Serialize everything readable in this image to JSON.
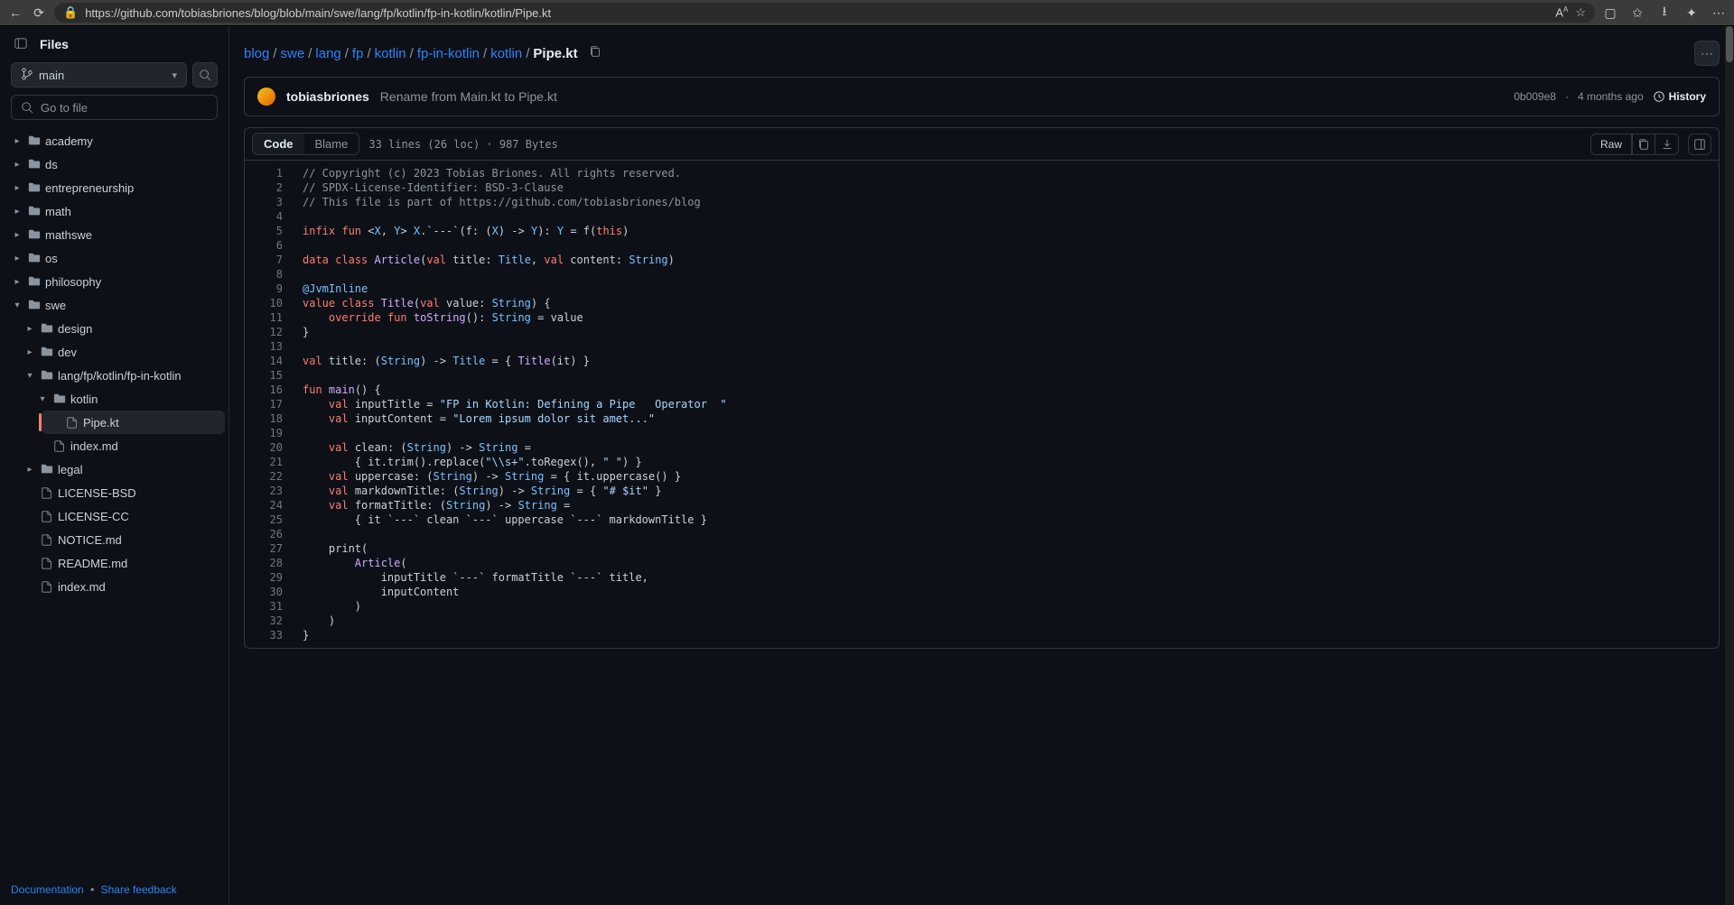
{
  "browser": {
    "url": "https://github.com/tobiasbriones/blog/blob/main/swe/lang/fp/kotlin/fp-in-kotlin/kotlin/Pipe.kt"
  },
  "sidebar": {
    "title": "Files",
    "branch": "main",
    "go_to_file": "Go to file",
    "items": [
      {
        "label": "academy",
        "type": "dir",
        "caret": ">",
        "indent": 0
      },
      {
        "label": "ds",
        "type": "dir",
        "caret": ">",
        "indent": 0
      },
      {
        "label": "entrepreneurship",
        "type": "dir",
        "caret": ">",
        "indent": 0
      },
      {
        "label": "math",
        "type": "dir",
        "caret": ">",
        "indent": 0
      },
      {
        "label": "mathswe",
        "type": "dir",
        "caret": ">",
        "indent": 0
      },
      {
        "label": "os",
        "type": "dir",
        "caret": ">",
        "indent": 0
      },
      {
        "label": "philosophy",
        "type": "dir",
        "caret": ">",
        "indent": 0
      },
      {
        "label": "swe",
        "type": "dir",
        "caret": "v",
        "indent": 0
      },
      {
        "label": "design",
        "type": "dir",
        "caret": ">",
        "indent": 1
      },
      {
        "label": "dev",
        "type": "dir",
        "caret": ">",
        "indent": 1
      },
      {
        "label": "lang/fp/kotlin/fp-in-kotlin",
        "type": "dir",
        "caret": "v",
        "indent": 1
      },
      {
        "label": "kotlin",
        "type": "dir",
        "caret": "v",
        "indent": 2
      },
      {
        "label": "Pipe.kt",
        "type": "file",
        "caret": "",
        "indent": 3,
        "active": true
      },
      {
        "label": "index.md",
        "type": "file",
        "caret": "",
        "indent": 2
      },
      {
        "label": "legal",
        "type": "dir",
        "caret": ">",
        "indent": 1
      },
      {
        "label": "LICENSE-BSD",
        "type": "file",
        "caret": "",
        "indent": 1
      },
      {
        "label": "LICENSE-CC",
        "type": "file",
        "caret": "",
        "indent": 1
      },
      {
        "label": "NOTICE.md",
        "type": "file",
        "caret": "",
        "indent": 1
      },
      {
        "label": "README.md",
        "type": "file",
        "caret": "",
        "indent": 1
      },
      {
        "label": "index.md",
        "type": "file",
        "caret": "",
        "indent": 1
      }
    ],
    "footer": {
      "docs": "Documentation",
      "sep": "•",
      "feedback": "Share feedback"
    }
  },
  "breadcrumb": [
    "blog",
    "swe",
    "lang",
    "fp",
    "kotlin",
    "fp-in-kotlin",
    "kotlin"
  ],
  "breadcrumb_current": "Pipe.kt",
  "commit": {
    "author": "tobiasbriones",
    "message": "Rename from Main.kt to Pipe.kt",
    "sha": "0b009e8",
    "when": "4 months ago",
    "history": "History"
  },
  "toolbar": {
    "code": "Code",
    "blame": "Blame",
    "meta": "33 lines (26 loc) · 987 Bytes",
    "raw": "Raw"
  },
  "code": {
    "line_count": 33,
    "lines": [
      [
        {
          "c": "cm",
          "t": "// Copyright (c) 2023 Tobias Briones. All rights reserved."
        }
      ],
      [
        {
          "c": "cm",
          "t": "// SPDX-License-Identifier: BSD-3-Clause"
        }
      ],
      [
        {
          "c": "cm",
          "t": "// This file is part of https://github.com/tobiasbriones/blog"
        }
      ],
      [],
      [
        {
          "c": "kw",
          "t": "infix"
        },
        {
          "t": " "
        },
        {
          "c": "kw",
          "t": "fun"
        },
        {
          "t": " <"
        },
        {
          "c": "tp",
          "t": "X"
        },
        {
          "t": ", "
        },
        {
          "c": "tp",
          "t": "Y"
        },
        {
          "t": "> "
        },
        {
          "c": "tp",
          "t": "X"
        },
        {
          "t": ".`---`(f: ("
        },
        {
          "c": "tp",
          "t": "X"
        },
        {
          "t": ") -> "
        },
        {
          "c": "tp",
          "t": "Y"
        },
        {
          "t": "): "
        },
        {
          "c": "tp",
          "t": "Y"
        },
        {
          "t": " = f("
        },
        {
          "c": "kw",
          "t": "this"
        },
        {
          "t": ")"
        }
      ],
      [],
      [
        {
          "c": "kw",
          "t": "data"
        },
        {
          "t": " "
        },
        {
          "c": "kw",
          "t": "class"
        },
        {
          "t": " "
        },
        {
          "c": "fn",
          "t": "Article"
        },
        {
          "t": "("
        },
        {
          "c": "kw",
          "t": "val"
        },
        {
          "t": " title: "
        },
        {
          "c": "tp",
          "t": "Title"
        },
        {
          "t": ", "
        },
        {
          "c": "kw",
          "t": "val"
        },
        {
          "t": " content: "
        },
        {
          "c": "tp",
          "t": "String"
        },
        {
          "t": ")"
        }
      ],
      [],
      [
        {
          "c": "nm",
          "t": "@JvmInline"
        }
      ],
      [
        {
          "c": "kw",
          "t": "value"
        },
        {
          "t": " "
        },
        {
          "c": "kw",
          "t": "class"
        },
        {
          "t": " "
        },
        {
          "c": "fn",
          "t": "Title"
        },
        {
          "t": "("
        },
        {
          "c": "kw",
          "t": "val"
        },
        {
          "t": " value: "
        },
        {
          "c": "tp",
          "t": "String"
        },
        {
          "t": ") {"
        }
      ],
      [
        {
          "t": "    "
        },
        {
          "c": "kw",
          "t": "override"
        },
        {
          "t": " "
        },
        {
          "c": "kw",
          "t": "fun"
        },
        {
          "t": " "
        },
        {
          "c": "fn",
          "t": "toString"
        },
        {
          "t": "(): "
        },
        {
          "c": "tp",
          "t": "String"
        },
        {
          "t": " = value"
        }
      ],
      [
        {
          "t": "}"
        }
      ],
      [],
      [
        {
          "c": "kw",
          "t": "val"
        },
        {
          "t": " title: ("
        },
        {
          "c": "tp",
          "t": "String"
        },
        {
          "t": ") -> "
        },
        {
          "c": "tp",
          "t": "Title"
        },
        {
          "t": " = { "
        },
        {
          "c": "fn",
          "t": "Title"
        },
        {
          "t": "(it) }"
        }
      ],
      [],
      [
        {
          "c": "kw",
          "t": "fun"
        },
        {
          "t": " "
        },
        {
          "c": "fn",
          "t": "main"
        },
        {
          "t": "() {"
        }
      ],
      [
        {
          "t": "    "
        },
        {
          "c": "kw",
          "t": "val"
        },
        {
          "t": " inputTitle = "
        },
        {
          "c": "st",
          "t": "\"FP in Kotlin: Defining a Pipe   Operator  \""
        }
      ],
      [
        {
          "t": "    "
        },
        {
          "c": "kw",
          "t": "val"
        },
        {
          "t": " inputContent = "
        },
        {
          "c": "st",
          "t": "\"Lorem ipsum dolor sit amet...\""
        }
      ],
      [],
      [
        {
          "t": "    "
        },
        {
          "c": "kw",
          "t": "val"
        },
        {
          "t": " clean: ("
        },
        {
          "c": "tp",
          "t": "String"
        },
        {
          "t": ") -> "
        },
        {
          "c": "tp",
          "t": "String"
        },
        {
          "t": " ="
        }
      ],
      [
        {
          "t": "        { it.trim().replace("
        },
        {
          "c": "st",
          "t": "\"\\\\s+\""
        },
        {
          "t": ".toRegex(), "
        },
        {
          "c": "st",
          "t": "\" \""
        },
        {
          "t": ") }"
        }
      ],
      [
        {
          "t": "    "
        },
        {
          "c": "kw",
          "t": "val"
        },
        {
          "t": " uppercase: ("
        },
        {
          "c": "tp",
          "t": "String"
        },
        {
          "t": ") -> "
        },
        {
          "c": "tp",
          "t": "String"
        },
        {
          "t": " = { it.uppercase() }"
        }
      ],
      [
        {
          "t": "    "
        },
        {
          "c": "kw",
          "t": "val"
        },
        {
          "t": " markdownTitle: ("
        },
        {
          "c": "tp",
          "t": "String"
        },
        {
          "t": ") -> "
        },
        {
          "c": "tp",
          "t": "String"
        },
        {
          "t": " = { "
        },
        {
          "c": "st",
          "t": "\"# $it\""
        },
        {
          "t": " }"
        }
      ],
      [
        {
          "t": "    "
        },
        {
          "c": "kw",
          "t": "val"
        },
        {
          "t": " formatTitle: ("
        },
        {
          "c": "tp",
          "t": "String"
        },
        {
          "t": ") -> "
        },
        {
          "c": "tp",
          "t": "String"
        },
        {
          "t": " ="
        }
      ],
      [
        {
          "t": "        { it `---` clean `---` uppercase `---` markdownTitle }"
        }
      ],
      [],
      [
        {
          "t": "    print("
        }
      ],
      [
        {
          "t": "        "
        },
        {
          "c": "fn",
          "t": "Article"
        },
        {
          "t": "("
        }
      ],
      [
        {
          "t": "            inputTitle `---` formatTitle `---` title,"
        }
      ],
      [
        {
          "t": "            inputContent"
        }
      ],
      [
        {
          "t": "        )"
        }
      ],
      [
        {
          "t": "    )"
        }
      ],
      [
        {
          "t": "}"
        }
      ]
    ]
  }
}
